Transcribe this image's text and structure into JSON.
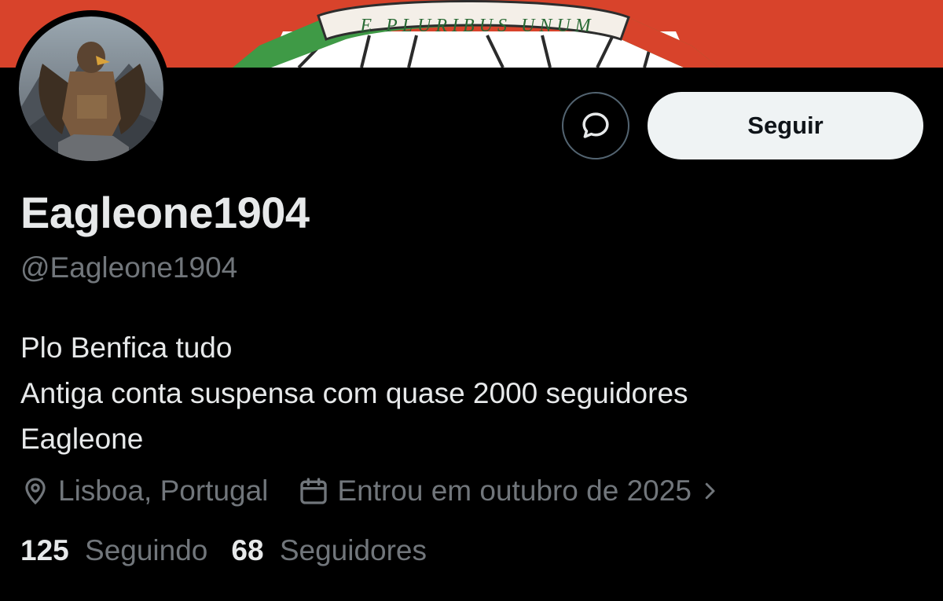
{
  "banner": {
    "motto": "E PLURIBUS UNUM",
    "background_color": "#d8432b"
  },
  "avatar": {
    "icon": "eagle-warrior-avatar"
  },
  "actions": {
    "message_icon": "chat-bubble-icon",
    "follow_label": "Seguir"
  },
  "profile": {
    "display_name": "Eagleone1904",
    "handle": "@Eagleone1904",
    "bio_lines": [
      "Plo Benfica tudo",
      "Antiga conta suspensa com quase 2000 seguidores",
      "Eagleone"
    ],
    "location": "Lisboa, Portugal",
    "joined": "Entrou em outubro de 2025"
  },
  "stats": {
    "following_count": "125",
    "following_label": "Seguindo",
    "followers_count": "68",
    "followers_label": "Seguidores"
  }
}
